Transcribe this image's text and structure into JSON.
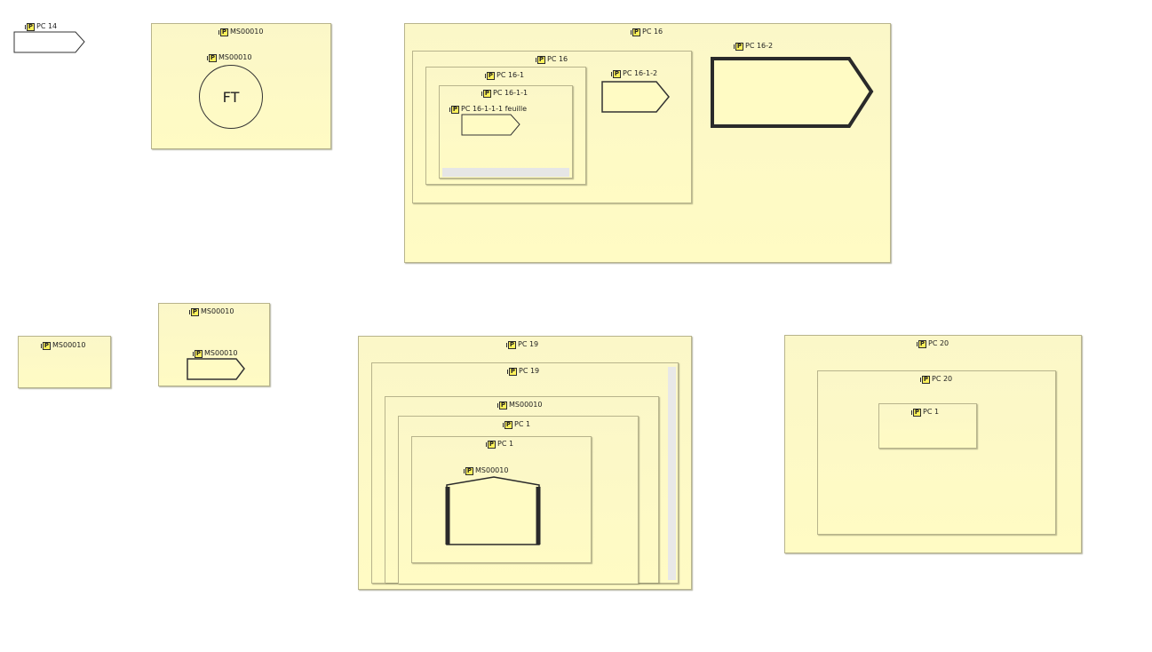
{
  "diagram": {
    "p_icon": "P",
    "nodes": {
      "pc14": "PC 14",
      "ms_top_outer": "MS00010",
      "ms_top_inner": "MS00010",
      "ft": "FT",
      "pc16_outer": "PC 16",
      "pc16_inner": "PC 16",
      "pc16_1": "PC 16-1",
      "pc16_1_1": "PC 16-1-1",
      "pc16_1_1_1": "PC 16-1-1-1 feuille",
      "pc16_1_2": "PC 16-1-2",
      "pc16_2": "PC 16-2",
      "ms_small": "MS00010",
      "ms_mid_outer": "MS00010",
      "ms_mid_inner": "MS00010",
      "pc19_outer": "PC 19",
      "pc19_inner": "PC 19",
      "ms_in19": "MS00010",
      "pc1_outer": "PC 1",
      "pc1_inner": "PC 1",
      "ms_in_pc1": "MS00010",
      "pc20_outer": "PC 20",
      "pc20_inner": "PC 20",
      "pc1_in20": "PC 1"
    },
    "colors": {
      "fill": "#fffbc4",
      "border": "#b8b48c",
      "icon": "#fff25a"
    }
  }
}
